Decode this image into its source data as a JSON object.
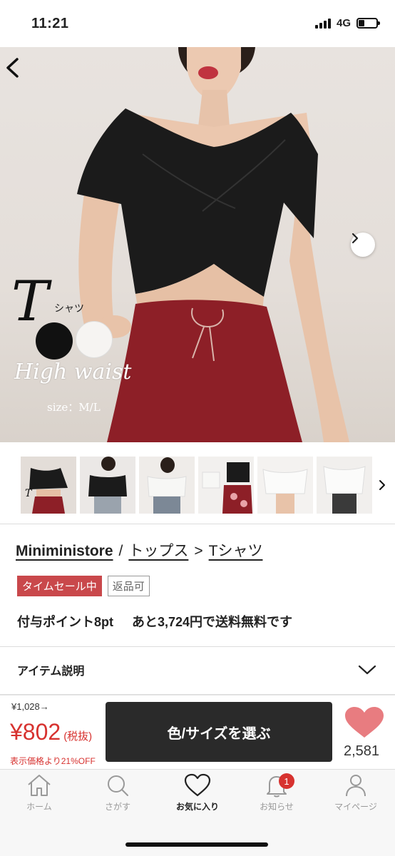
{
  "status_bar": {
    "time": "11:21",
    "network": "4G"
  },
  "hero": {
    "title_letter": "T",
    "title_kana": "シャツ",
    "tagline": "High waist",
    "size_text": "size：M/L",
    "colors": {
      "skin": "#e9c8b0",
      "top": "#1b1b1b",
      "skirt": "#8d1f27",
      "background": "#e6e0db"
    }
  },
  "product": {
    "store": "Miniministore",
    "separator": "/",
    "category": "トップス",
    "arrow": ">",
    "subcategory": "Tシャツ",
    "badges": {
      "sale": "タイムセール中",
      "returnable": "返品可"
    },
    "points": "付与ポイント8pt",
    "shipping_note": "あと3,724円で送料無料です"
  },
  "item_description": {
    "label": "アイテム説明"
  },
  "purchase": {
    "original_price": "¥1,028→",
    "price": "¥802",
    "tax_note": "(税抜)",
    "discount": "表示価格より21%OFF",
    "select_button": "色/サイズを選ぶ",
    "favorite_count": "2,581",
    "accent_color": "#d7322f",
    "heart_color": "#e87c80"
  },
  "tabs": [
    {
      "label": "ホーム",
      "icon": "home-icon"
    },
    {
      "label": "さがす",
      "icon": "search-icon"
    },
    {
      "label": "お気に入り",
      "icon": "heart-icon",
      "active": true
    },
    {
      "label": "お知らせ",
      "icon": "bell-icon",
      "badge": "1"
    },
    {
      "label": "マイページ",
      "icon": "person-icon"
    }
  ]
}
